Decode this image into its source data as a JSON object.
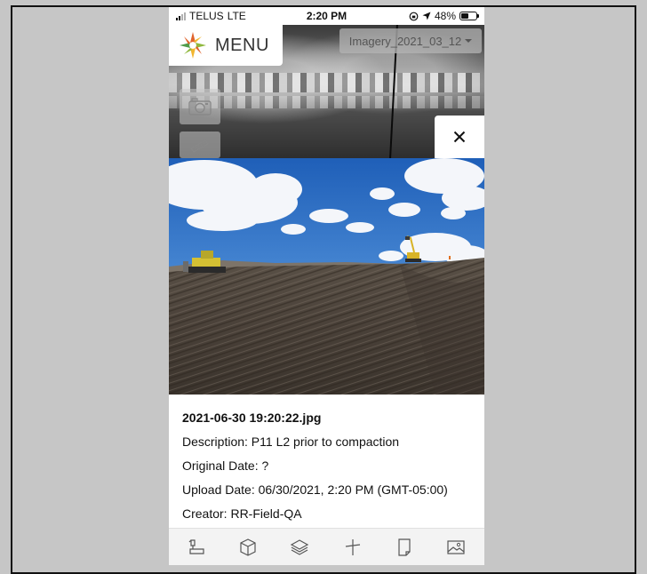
{
  "status_bar": {
    "carrier": "TELUS",
    "network": "LTE",
    "time": "2:20 PM",
    "battery": "48%",
    "battery_level": 0.48
  },
  "header": {
    "menu_label": "MENU",
    "imagery_select": "Imagery_2021_03_12"
  },
  "map_tools": [
    "camera-icon",
    "ruler-icon"
  ],
  "photo_info": {
    "filename": "2021-06-30 19:20:22.jpg",
    "description": "Description: P11 L2 prior to compaction",
    "original_date": "Original Date: ?",
    "upload_date": "Upload Date: 06/30/2021, 2:20 PM (GMT-05:00)",
    "creator": "Creator: RR-Field-QA"
  },
  "toolbar": [
    "measure-icon",
    "cube-icon",
    "layers-icon",
    "plus-icon",
    "document-icon",
    "image-icon"
  ],
  "colors": {
    "background": "#c6c6c6",
    "panel": "#ffffff",
    "toolbar": "#f3f3f3"
  }
}
